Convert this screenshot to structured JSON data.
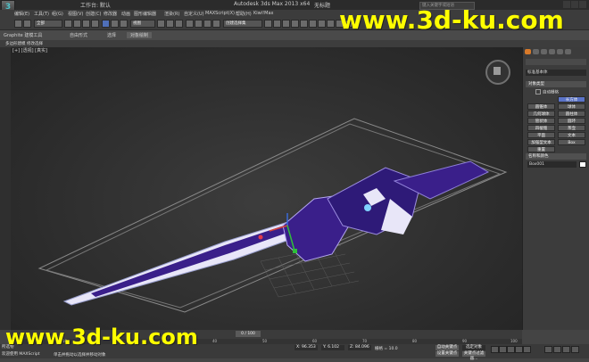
{
  "app": {
    "logo_glyph": "3",
    "workspace_label": "工作台: 默认",
    "title": "Autodesk 3ds Max 2013 x64",
    "file_name": "无标题",
    "search_placeholder": "键入关键字或短语"
  },
  "menu": [
    "编辑(E)",
    "工具(T)",
    "组(G)",
    "视图(V)",
    "创建(C)",
    "修改器",
    "动画",
    "图形编辑器",
    "渲染(R)",
    "自定义(U)",
    "MAXScript(X)",
    "帮助(H)",
    "Kiwi!Max"
  ],
  "toolbar": {
    "selection_filter": "全部",
    "ref_coord": "视图",
    "named_selection": "创建选择集"
  },
  "ribbon": {
    "tabs": [
      {
        "label": "Graphite 建模工具",
        "active": false
      },
      {
        "label": "自由形式",
        "active": false
      },
      {
        "label": "选择",
        "active": false
      },
      {
        "label": "对象绘制",
        "active": true
      }
    ],
    "sub_label_1": "多边形建模",
    "sub_label_2": "修改选择"
  },
  "viewport": {
    "label": "[+] [透视] [真实]"
  },
  "command_panel": {
    "category_dropdown": "标准基本体",
    "rollout_object_type": "对象类型",
    "autogrid_label": "自动栅格",
    "object_buttons": [
      {
        "label": "长方体",
        "selected": true
      },
      {
        "label": "圆锥体",
        "selected": false
      },
      {
        "label": "球体",
        "selected": false
      },
      {
        "label": "几何球体",
        "selected": false
      },
      {
        "label": "圆柱体",
        "selected": false
      },
      {
        "label": "管状体",
        "selected": false
      },
      {
        "label": "圆环",
        "selected": false
      },
      {
        "label": "四棱锥",
        "selected": false
      },
      {
        "label": "茶壶",
        "selected": false
      },
      {
        "label": "平面",
        "selected": false
      },
      {
        "label": "文本",
        "selected": false
      },
      {
        "label": "加强型文本",
        "selected": false
      },
      {
        "label": "Box",
        "selected": false
      },
      {
        "label": "重置",
        "selected": false
      }
    ],
    "rollout_name_color": "名称和颜色",
    "object_name": "Box001",
    "swatch_color": "#ffffff"
  },
  "timeline": {
    "frame_display": "0 / 100",
    "ticks": [
      "0",
      "10",
      "20",
      "30",
      "40",
      "50",
      "60",
      "70",
      "80",
      "90",
      "100"
    ]
  },
  "status": {
    "left_line_1": "所选物",
    "left_line_2": "欢迎使用 MAXScript",
    "prompt": "单击并拖动以选择并移动对象",
    "x": "X: 96.353",
    "y": "Y: 6.102",
    "z": "Z: 84.096",
    "grid": "栅格 = 10.0",
    "auto_key": "自动关键点",
    "set_key": "设置关键点",
    "key_filter": "选定对象",
    "key_filters_btn": "关键点过滤器..."
  },
  "watermarks": {
    "top": "www.3d-ku.com",
    "bottom": "www.3d-ku.com"
  },
  "colors": {
    "sword_purple": "#3a1f8a",
    "sword_blade": "#e8e6f8",
    "gizmo_green": "#2fbf3a",
    "watermark": "#ffff00",
    "selected_button": "#5b74c8"
  }
}
